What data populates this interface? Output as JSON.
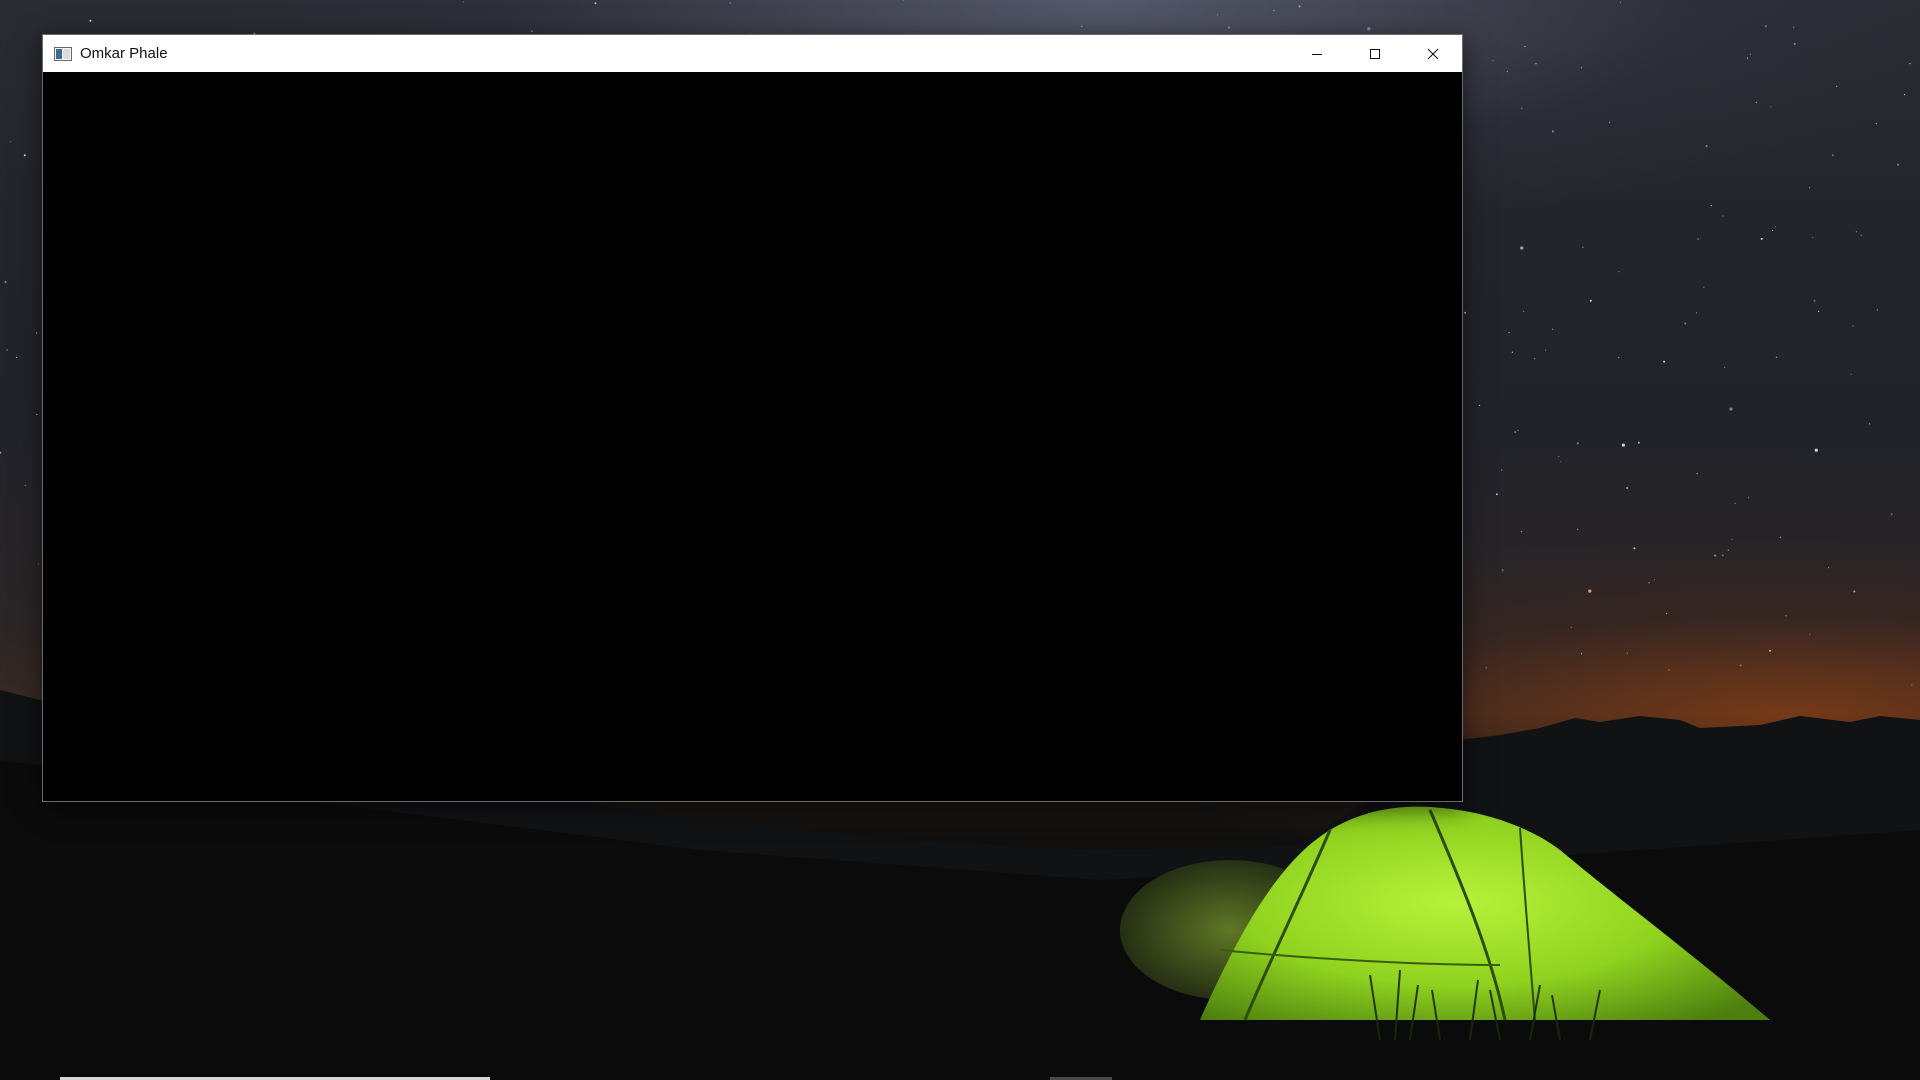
{
  "window": {
    "title": "Omkar Phale",
    "icon": "app-window-icon",
    "buttons": {
      "minimize": "minimize-icon",
      "maximize": "maximize-icon",
      "close": "close-icon"
    },
    "client_background": "#000000"
  },
  "desktop": {
    "wallpaper": "night-sky-green-tent"
  }
}
